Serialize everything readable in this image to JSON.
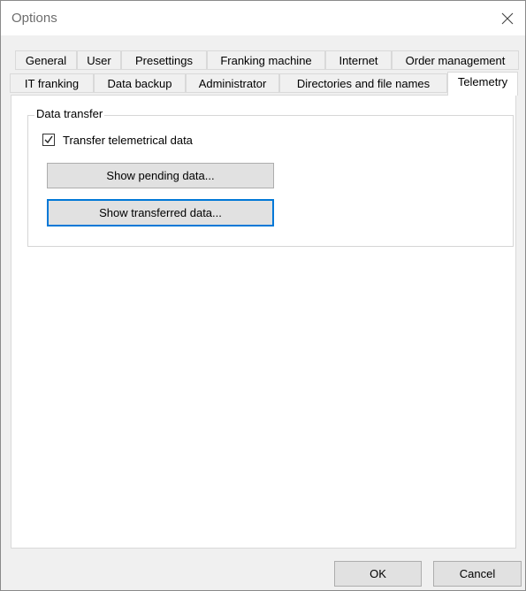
{
  "window": {
    "title": "Options"
  },
  "tabs_row1": [
    "General",
    "User",
    "Presettings",
    "Franking machine",
    "Internet",
    "Order management"
  ],
  "tabs_row2": [
    "IT franking",
    "Data backup",
    "Administrator",
    "Directories and file names",
    "Telemetry"
  ],
  "active_tab": "Telemetry",
  "data_transfer": {
    "group_label": "Data transfer",
    "checkbox_label": "Transfer telemetrical data",
    "checkbox_checked": true,
    "show_pending_label": "Show pending data...",
    "show_transferred_label": "Show transferred data..."
  },
  "footer": {
    "ok_label": "OK",
    "cancel_label": "Cancel"
  },
  "colors": {
    "focus_border": "#0078d7",
    "button_bg": "#e1e1e1",
    "window_bg": "#f0f0f0"
  }
}
